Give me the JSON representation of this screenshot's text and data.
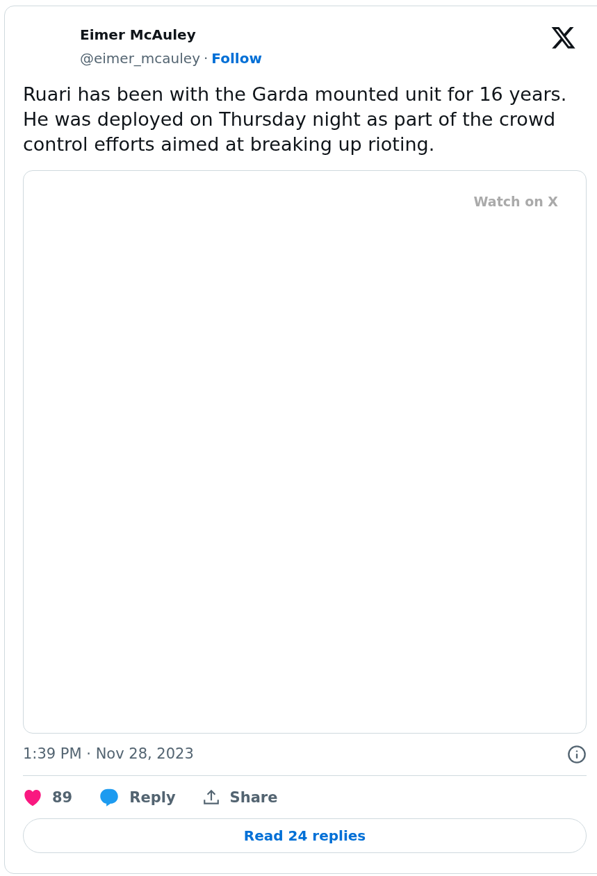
{
  "author": {
    "name": "Eimer McAuley",
    "handle": "@eimer_mcauley",
    "separator": "·",
    "follow": "Follow"
  },
  "text": "Ruari has been with the Garda mounted unit for 16 years. He was deployed on Thursday night as part of the crowd control efforts aimed at breaking up rioting.",
  "media": {
    "watch_label": "Watch on X"
  },
  "timestamp": "1:39 PM · Nov 28, 2023",
  "actions": [
    {
      "kind": "like",
      "label": "89"
    },
    {
      "kind": "reply",
      "label": "Reply"
    },
    {
      "kind": "share",
      "label": "Share"
    }
  ],
  "read_replies": "Read 24 replies"
}
